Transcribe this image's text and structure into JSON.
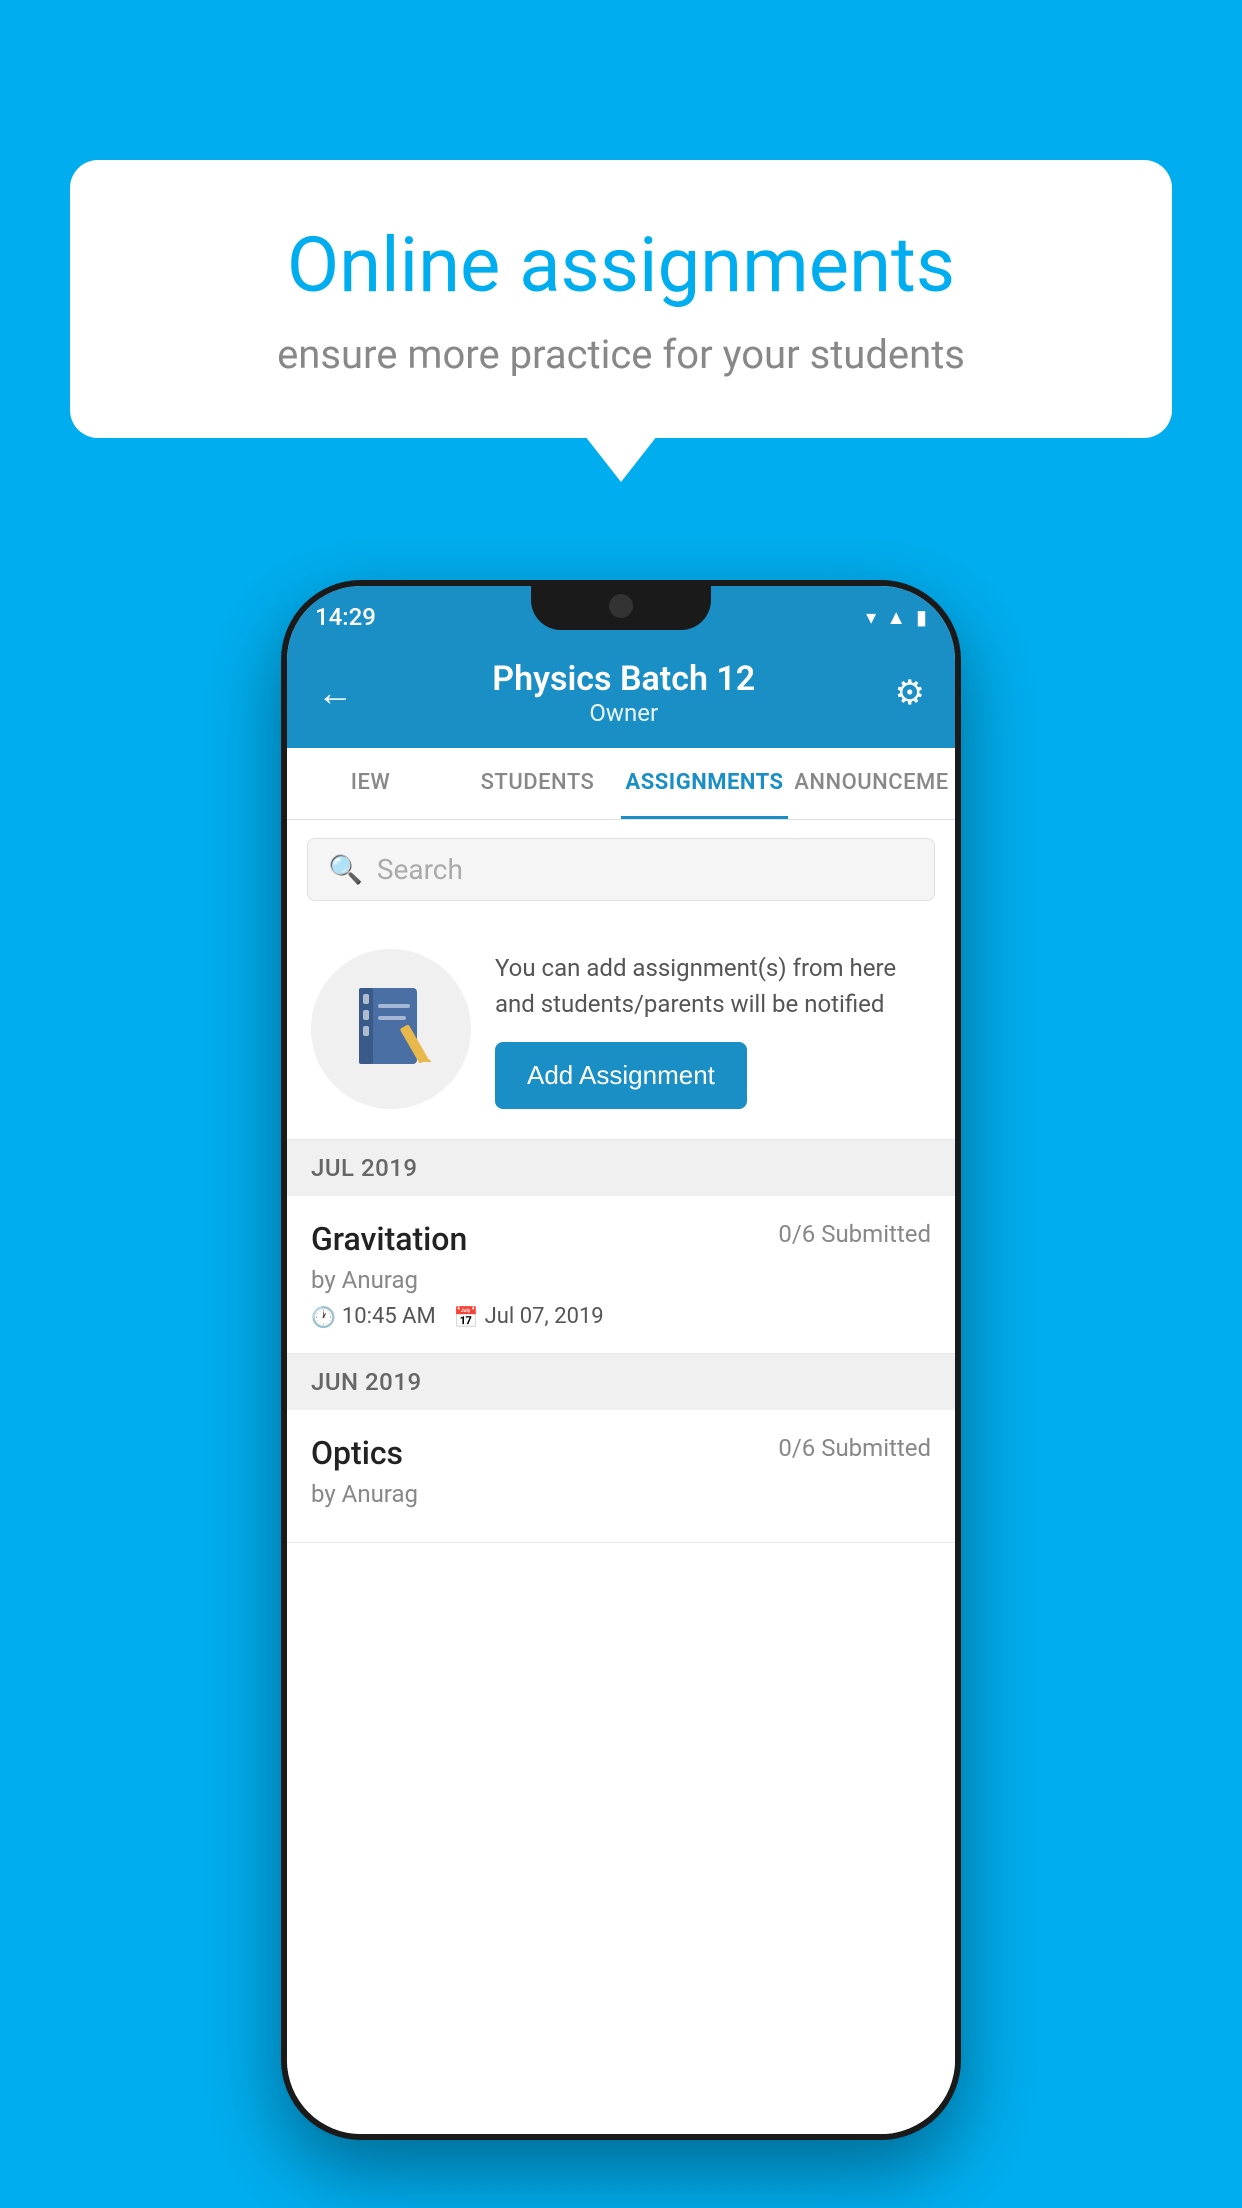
{
  "background_color": "#00AEEF",
  "speech_bubble": {
    "title": "Online assignments",
    "subtitle": "ensure more practice for your students"
  },
  "phone": {
    "status_bar": {
      "time": "14:29",
      "wifi": "▾",
      "signal": "▲",
      "battery": "▮"
    },
    "header": {
      "title": "Physics Batch 12",
      "subtitle": "Owner",
      "back_label": "←",
      "settings_label": "⚙"
    },
    "tabs": [
      {
        "label": "IEW",
        "active": false
      },
      {
        "label": "STUDENTS",
        "active": false
      },
      {
        "label": "ASSIGNMENTS",
        "active": true
      },
      {
        "label": "ANNOUNCEME",
        "active": false
      }
    ],
    "search": {
      "placeholder": "Search"
    },
    "promo": {
      "text": "You can add assignment(s) from here and students/parents will be notified",
      "button_label": "Add Assignment"
    },
    "months": [
      {
        "label": "JUL 2019",
        "assignments": [
          {
            "title": "Gravitation",
            "submitted": "0/6 Submitted",
            "by": "by Anurag",
            "time": "10:45 AM",
            "date": "Jul 07, 2019"
          }
        ]
      },
      {
        "label": "JUN 2019",
        "assignments": [
          {
            "title": "Optics",
            "submitted": "0/6 Submitted",
            "by": "by Anurag",
            "time": "",
            "date": ""
          }
        ]
      }
    ]
  }
}
